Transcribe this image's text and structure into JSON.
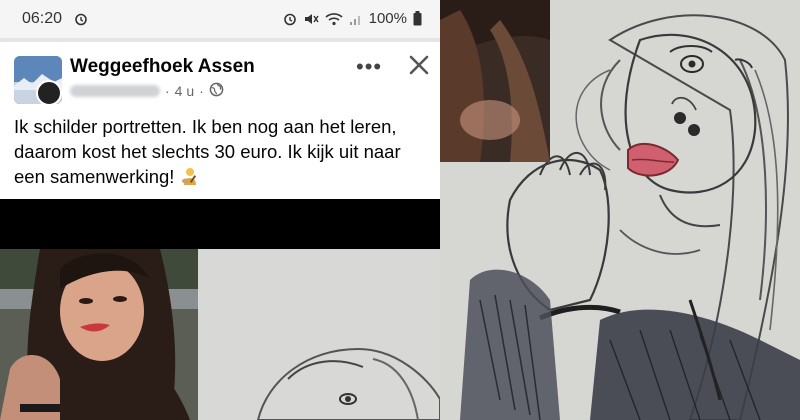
{
  "status_bar": {
    "time": "06:20",
    "battery": "100%",
    "icons": [
      "alarm-icon",
      "mute-icon",
      "wifi-icon",
      "signal-icon",
      "battery-icon"
    ]
  },
  "post": {
    "group_name": "Weggeefhoek Assen",
    "time_ago": "4 u",
    "separator": "·",
    "text": "Ik schilder portretten. Ik ben nog aan het leren, daarom kost het slechts 30 euro. Ik kijk uit naar een samenwerking!",
    "more_label": "•••",
    "icons": [
      "globe-icon",
      "close-icon",
      "artist-emoji"
    ]
  },
  "colors": {
    "text": "#050505",
    "meta": "#65676b",
    "lips": "#d06070"
  }
}
